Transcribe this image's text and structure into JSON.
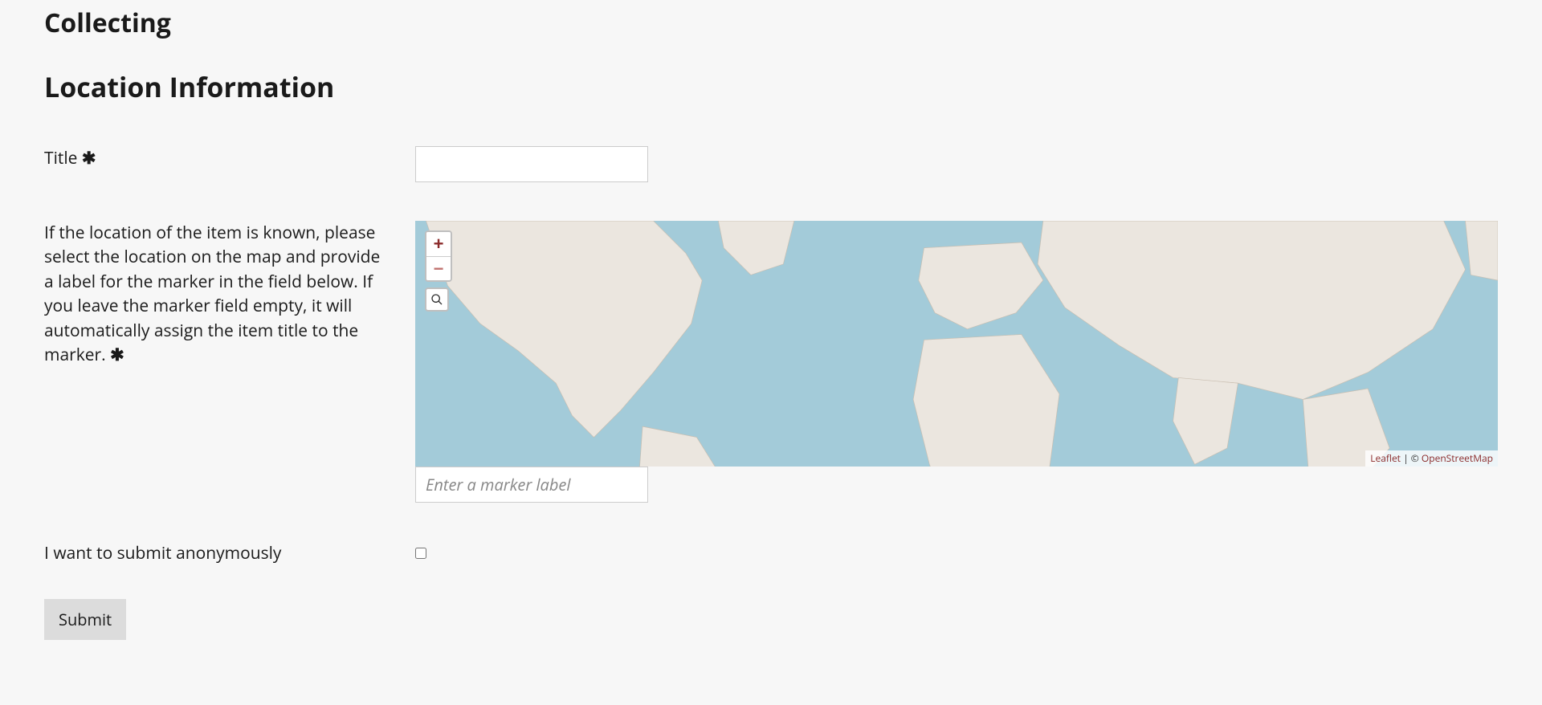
{
  "headings": {
    "collecting": "Collecting",
    "section": "Location Information"
  },
  "form": {
    "title_label": "Title",
    "title_value": "",
    "required_glyph": "✱",
    "location_instructions": "If the location of the item is known, please select the location on the map and provide a label for the marker in the field below. If you leave the marker field empty, it will automatically assign the item title to the marker.",
    "marker_placeholder": "Enter a marker label",
    "marker_value": "",
    "anonymous_label": "I want to submit anonymously",
    "anonymous_checked": false,
    "submit_label": "Submit"
  },
  "map": {
    "zoom_in": "+",
    "zoom_out": "−",
    "attribution_leaflet": "Leaflet",
    "attribution_sep": " | © ",
    "attribution_osm": "OpenStreetMap"
  }
}
